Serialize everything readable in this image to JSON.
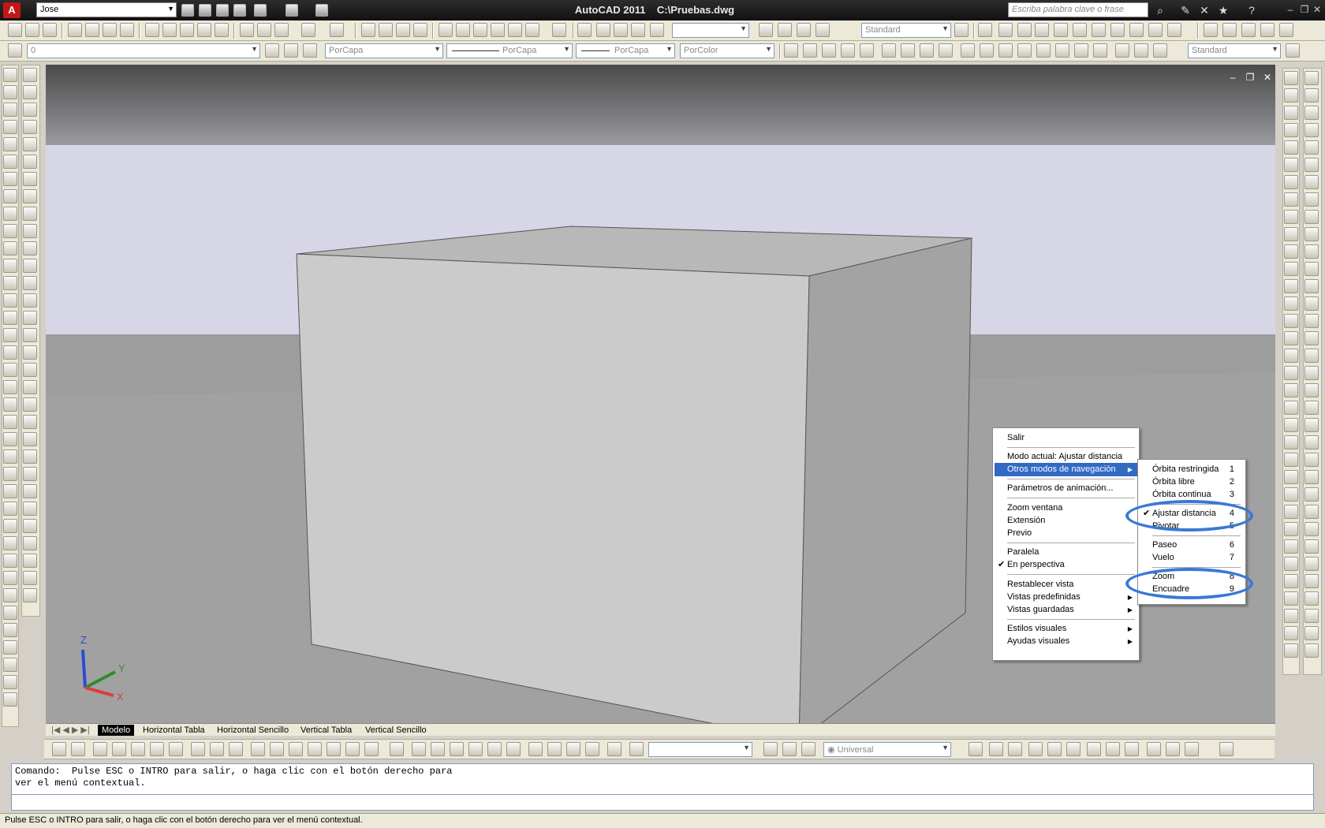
{
  "app": {
    "title": "AutoCAD 2011    C:\\Pruebas.dwg",
    "logo": "A",
    "workspace": "Jose",
    "search_placeholder": "Escriba palabra clave o frase"
  },
  "toolbar": {
    "layer_value": "0",
    "color_value": "PorCapa",
    "linetype_value": "PorCapa",
    "lineweight_value": "PorCapa",
    "plotstyle_value": "PorColor",
    "textstyle_value": "Standard",
    "dimstyle_value": "Standard",
    "ucs_value": "Universal"
  },
  "layout_tabs": [
    "Modelo",
    "Horizontal Tabla",
    "Horizontal Sencillo",
    "Vertical Tabla",
    "Vertical Sencillo"
  ],
  "context_menu": {
    "exit": "Salir",
    "current_mode": "Modo actual: Ajustar distancia",
    "other_modes": "Otros modos de navegación",
    "animation": "Parámetros de animación...",
    "zoom_window": "Zoom ventana",
    "extents": "Extensión",
    "previous": "Previo",
    "parallel": "Paralela",
    "perspective": "En perspectiva",
    "reset_view": "Restablecer vista",
    "preset_views": "Vistas predefinidas",
    "saved_views": "Vistas guardadas",
    "visual_styles": "Estilos visuales",
    "visual_aids": "Ayudas visuales"
  },
  "submenu": {
    "items": [
      {
        "label": "Órbita restringida",
        "key": "1"
      },
      {
        "label": "Órbita libre",
        "key": "2"
      },
      {
        "label": "Órbita continua",
        "key": "3"
      },
      {
        "label": "Ajustar distancia",
        "key": "4"
      },
      {
        "label": "Pivotar",
        "key": "5"
      },
      {
        "label": "Paseo",
        "key": "6"
      },
      {
        "label": "Vuelo",
        "key": "7"
      },
      {
        "label": "Zoom",
        "key": "8"
      },
      {
        "label": "Encuadre",
        "key": "9"
      }
    ]
  },
  "ucs_icon": {
    "x": "X",
    "y": "Y",
    "z": "Z"
  },
  "command": {
    "line1": "Comando:  Pulse ESC o INTRO para salir, o haga clic con el botón derecho para",
    "line2": "ver el menú contextual."
  },
  "status": "Pulse ESC o INTRO para salir, o haga clic con el botón derecho para ver el menú contextual.",
  "colors": {
    "highlight": "#316ac5",
    "circle": "#3a78d6"
  }
}
